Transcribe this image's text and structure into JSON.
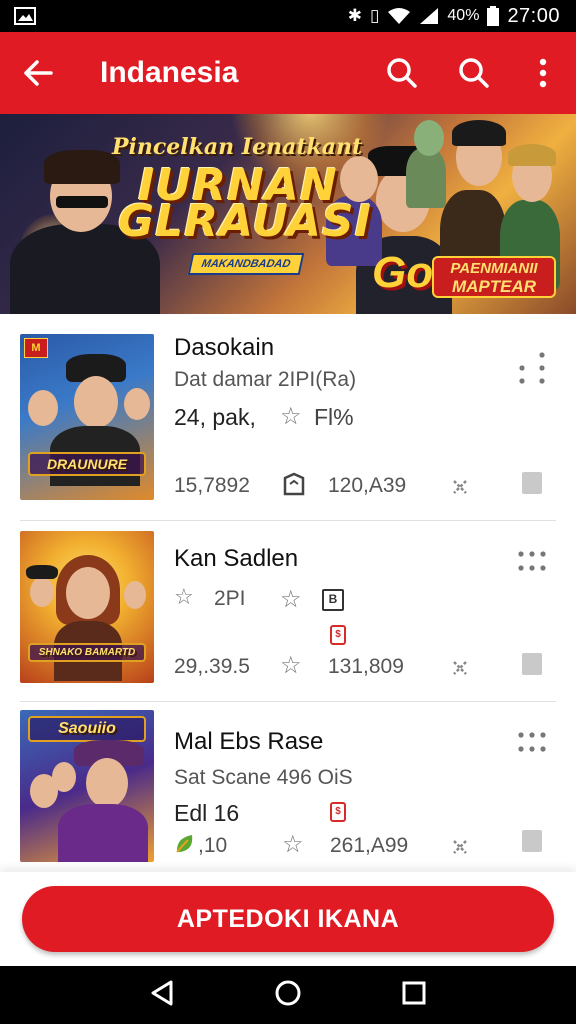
{
  "status_bar": {
    "battery_percent": "40%",
    "time": "27:00"
  },
  "app_bar": {
    "title": "Indanesia",
    "back_icon": "arrow-left-icon",
    "actions": [
      "search-icon",
      "search-icon",
      "more-vert-icon"
    ]
  },
  "banner": {
    "subtitle": "Pincelkan Ienatkant",
    "title_line1": "IURNAN",
    "title_line2": "GLRAUASI",
    "tag": "MAKANDBADAD",
    "go": "Go",
    "badge_line1": "PAENMIANII",
    "badge_line2": "MAPTEAR"
  },
  "games": [
    {
      "title": "Dasokain",
      "line1": "Dat damar 2IPI(Ra)",
      "line2": "24, pak,",
      "line2_suffix": "Fl%",
      "thumb_label": "DRAUNURE",
      "stat_left": "15,7892",
      "stat_right": "120,A39",
      "colors": {
        "bg1": "#2b5aa8",
        "bg2": "#e08a2a"
      }
    },
    {
      "title": "Kan Sadlen",
      "line1": "2PI",
      "line2": "",
      "thumb_label": "SHNAKO BAMARTD",
      "stat_left": "29,.39.5",
      "stat_right": "131,809",
      "colors": {
        "bg1": "#f2b030",
        "bg2": "#b8401a"
      }
    },
    {
      "title": "Mal Ebs Rase",
      "line1": "Sat Scane 496 OiS",
      "line2": "Edl 16",
      "thumb_label": "Saouiio",
      "stat_left": ",10",
      "stat_right": "261,A99",
      "colors": {
        "bg1": "#4a2a8a",
        "bg2": "#f0a030"
      }
    }
  ],
  "cta": {
    "label": "APTEDOKI IKANA"
  },
  "colors": {
    "primary": "#e01b24",
    "status_bar": "#000000",
    "nav_bar": "#000000"
  }
}
